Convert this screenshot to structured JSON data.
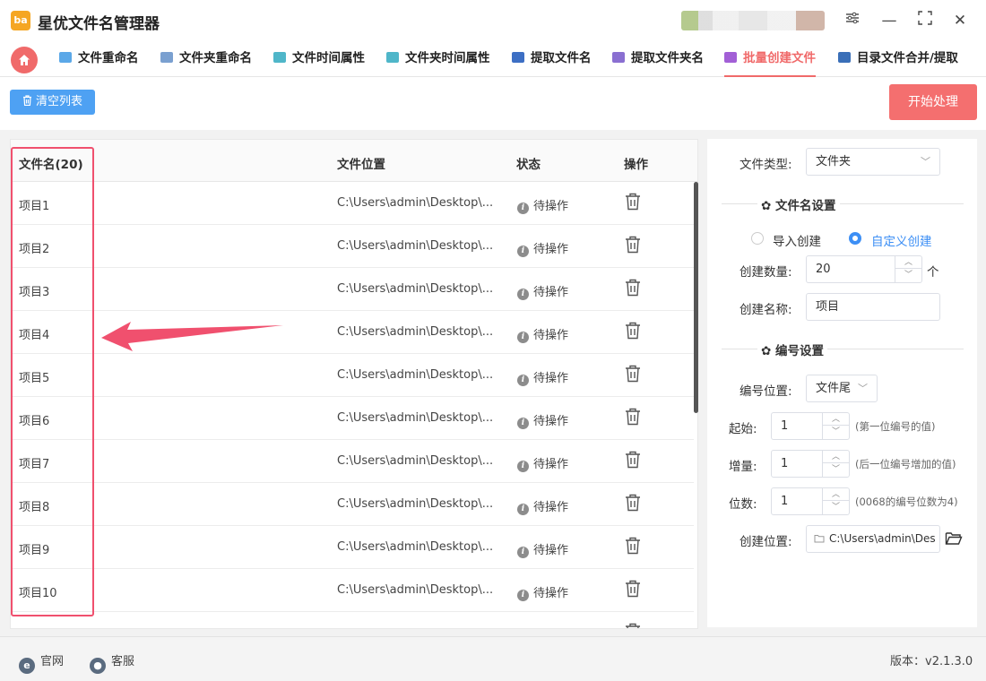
{
  "app": {
    "title": "星优文件名管理器",
    "logo_text": "ba"
  },
  "window": {
    "settings": "⚙",
    "minimize": "—",
    "maximize": "⛶",
    "close": "✕"
  },
  "nav": {
    "home_icon": "home-icon",
    "tabs": [
      {
        "label": "文件重命名",
        "icon_color": "#5ba8e8"
      },
      {
        "label": "文件夹重命名",
        "icon_color": "#7aa0d0"
      },
      {
        "label": "文件时间属性",
        "icon_color": "#4fb6c9"
      },
      {
        "label": "文件夹时间属性",
        "icon_color": "#4fb6c9"
      },
      {
        "label": "提取文件名",
        "icon_color": "#3d6fc4"
      },
      {
        "label": "提取文件夹名",
        "icon_color": "#8a6fd1"
      },
      {
        "label": "批量创建文件",
        "icon_color": "#a25fd6",
        "active": true
      },
      {
        "label": "目录文件合并/提取",
        "icon_color": "#3a6fb8"
      }
    ]
  },
  "toolbar": {
    "clear_label": "清空列表",
    "start_label": "开始处理"
  },
  "table": {
    "headers": {
      "name": "文件名(20)",
      "location": "文件位置",
      "status": "状态",
      "action": "操作"
    },
    "rows": [
      {
        "name": "项目1",
        "location": "C:\\Users\\admin\\Desktop\\...",
        "status": "待操作"
      },
      {
        "name": "项目2",
        "location": "C:\\Users\\admin\\Desktop\\...",
        "status": "待操作"
      },
      {
        "name": "项目3",
        "location": "C:\\Users\\admin\\Desktop\\...",
        "status": "待操作"
      },
      {
        "name": "项目4",
        "location": "C:\\Users\\admin\\Desktop\\...",
        "status": "待操作"
      },
      {
        "name": "项目5",
        "location": "C:\\Users\\admin\\Desktop\\...",
        "status": "待操作"
      },
      {
        "name": "项目6",
        "location": "C:\\Users\\admin\\Desktop\\...",
        "status": "待操作"
      },
      {
        "name": "项目7",
        "location": "C:\\Users\\admin\\Desktop\\...",
        "status": "待操作"
      },
      {
        "name": "项目8",
        "location": "C:\\Users\\admin\\Desktop\\...",
        "status": "待操作"
      },
      {
        "name": "项目9",
        "location": "C:\\Users\\admin\\Desktop\\...",
        "status": "待操作"
      },
      {
        "name": "项目10",
        "location": "C:\\Users\\admin\\Desktop\\...",
        "status": "待操作"
      }
    ]
  },
  "settings": {
    "file_type_label": "文件类型:",
    "file_type_value": "文件夹",
    "name_section": "文件名设置",
    "radio_import": "导入创建",
    "radio_custom": "自定义创建",
    "selected_mode": "自定义创建",
    "count_label": "创建数量:",
    "count_value": "20",
    "count_unit": "个",
    "name_label": "创建名称:",
    "name_value": "项目",
    "number_section": "编号设置",
    "position_label": "编号位置:",
    "position_value": "文件尾",
    "start_label": "起始:",
    "start_value": "1",
    "start_hint": "(第一位编号的值)",
    "step_label": "增量:",
    "step_value": "1",
    "step_hint": "(后一位编号增加的值)",
    "digits_label": "位数:",
    "digits_value": "1",
    "digits_hint": "(0068的编号位数为4)",
    "location_label": "创建位置:",
    "location_value": "C:\\Users\\admin\\Des"
  },
  "footer": {
    "website": "官网",
    "support": "客服",
    "version": "版本：v2.1.3.0"
  },
  "colors": {
    "accent": "#f06a6a",
    "primary": "#4ea1f3",
    "annotation": "#f0506e"
  }
}
